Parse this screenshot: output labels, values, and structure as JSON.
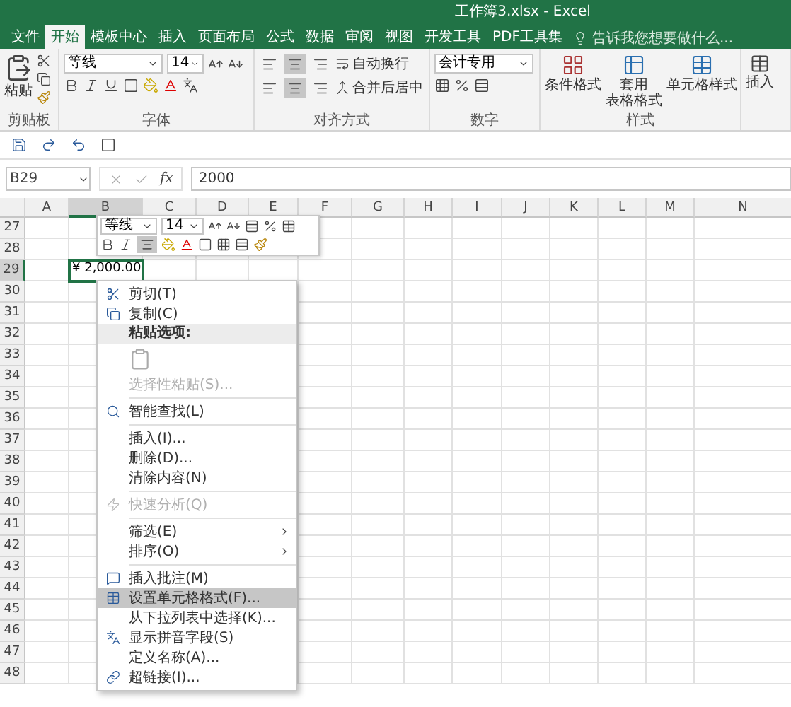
{
  "window": {
    "title": "工作簿3.xlsx - Excel"
  },
  "tabs": [
    {
      "label": "文件",
      "selected": false
    },
    {
      "label": "开始",
      "selected": true
    },
    {
      "label": "模板中心",
      "selected": false
    },
    {
      "label": "插入",
      "selected": false
    },
    {
      "label": "页面布局",
      "selected": false
    },
    {
      "label": "公式",
      "selected": false
    },
    {
      "label": "数据",
      "selected": false
    },
    {
      "label": "审阅",
      "selected": false
    },
    {
      "label": "视图",
      "selected": false
    },
    {
      "label": "开发工具",
      "selected": false
    },
    {
      "label": "PDF工具集",
      "selected": false
    }
  ],
  "tell_me": {
    "placeholder": "告诉我您想要做什么..."
  },
  "ribbon": {
    "clipboard": {
      "paste": "粘贴",
      "label": "剪贴板"
    },
    "font": {
      "name": "等线",
      "size": "14",
      "label": "字体"
    },
    "alignment": {
      "wrap": "自动换行",
      "merge": "合并后居中",
      "label": "对齐方式",
      "buttons": [
        {
          "selected": false
        },
        {
          "selected": true
        },
        {
          "selected": false
        },
        {
          "selected": false
        },
        {
          "selected": true
        },
        {
          "selected": false
        }
      ]
    },
    "number": {
      "format": "会计专用",
      "label": "数字"
    },
    "styles": {
      "conditional": "条件格式",
      "table_line1": "套用",
      "table_line2": "表格格式",
      "cell_styles": "单元格样式",
      "label": "样式"
    },
    "cells": {
      "insert": "插入"
    }
  },
  "formula_bar": {
    "name_box": "B29",
    "function_label": "fx",
    "value": "2000"
  },
  "grid": {
    "columns": [
      "A",
      "B",
      "C",
      "D",
      "E",
      "F",
      "G",
      "H",
      "I",
      "J",
      "K",
      "L",
      "M",
      "N"
    ],
    "rows": [
      {
        "header": "27",
        "cells": []
      },
      {
        "header": "28",
        "cells": []
      },
      {
        "header": "29",
        "cells": [
          {},
          {
            "value": "¥ 2,000.00",
            "selected": true
          }
        ]
      },
      {
        "header": "30",
        "cells": []
      },
      {
        "header": "31",
        "cells": []
      },
      {
        "header": "32",
        "cells": []
      },
      {
        "header": "33",
        "cells": []
      },
      {
        "header": "34",
        "cells": []
      },
      {
        "header": "35",
        "cells": []
      },
      {
        "header": "36",
        "cells": []
      },
      {
        "header": "37",
        "cells": []
      },
      {
        "header": "38",
        "cells": []
      },
      {
        "header": "39",
        "cells": []
      },
      {
        "header": "40",
        "cells": []
      },
      {
        "header": "41",
        "cells": []
      },
      {
        "header": "42",
        "cells": []
      },
      {
        "header": "43",
        "cells": []
      },
      {
        "header": "44",
        "cells": []
      },
      {
        "header": "45",
        "cells": []
      },
      {
        "header": "46",
        "cells": []
      },
      {
        "header": "47",
        "cells": []
      },
      {
        "header": "48",
        "cells": []
      }
    ]
  },
  "mini_toolbar": {
    "font": "等线",
    "size": "14",
    "center_on": true
  },
  "context_menu": [
    {
      "kind": "item",
      "label": "剪切(T)",
      "disabled": false,
      "submenu": false,
      "selected": false
    },
    {
      "kind": "item",
      "label": "复制(C)",
      "disabled": false,
      "submenu": false,
      "selected": false
    },
    {
      "kind": "header",
      "label": "粘贴选项:"
    },
    {
      "kind": "paste"
    },
    {
      "kind": "item",
      "label": "选择性粘贴(S)...",
      "disabled": true,
      "submenu": false,
      "selected": false
    },
    {
      "kind": "separator"
    },
    {
      "kind": "item",
      "label": "智能查找(L)",
      "disabled": false,
      "submenu": false,
      "selected": false
    },
    {
      "kind": "separator"
    },
    {
      "kind": "item",
      "label": "插入(I)...",
      "disabled": false,
      "submenu": false,
      "selected": false
    },
    {
      "kind": "item",
      "label": "删除(D)...",
      "disabled": false,
      "submenu": false,
      "selected": false
    },
    {
      "kind": "item",
      "label": "清除内容(N)",
      "disabled": false,
      "submenu": false,
      "selected": false
    },
    {
      "kind": "separator"
    },
    {
      "kind": "item",
      "label": "快速分析(Q)",
      "disabled": true,
      "submenu": false,
      "selected": false
    },
    {
      "kind": "separator"
    },
    {
      "kind": "item",
      "label": "筛选(E)",
      "disabled": false,
      "submenu": true,
      "selected": false
    },
    {
      "kind": "item",
      "label": "排序(O)",
      "disabled": false,
      "submenu": true,
      "selected": false
    },
    {
      "kind": "separator"
    },
    {
      "kind": "item",
      "label": "插入批注(M)",
      "disabled": false,
      "submenu": false,
      "selected": false
    },
    {
      "kind": "item",
      "label": "设置单元格格式(F)...",
      "disabled": false,
      "submenu": false,
      "selected": true
    },
    {
      "kind": "item",
      "label": "从下拉列表中选择(K)...",
      "disabled": false,
      "submenu": false,
      "selected": false
    },
    {
      "kind": "item",
      "label": "显示拼音字段(S)",
      "disabled": false,
      "submenu": false,
      "selected": false
    },
    {
      "kind": "item",
      "label": "定义名称(A)...",
      "disabled": false,
      "submenu": false,
      "selected": false
    },
    {
      "kind": "item",
      "label": "超链接(I)...",
      "disabled": false,
      "submenu": false,
      "selected": false
    }
  ]
}
